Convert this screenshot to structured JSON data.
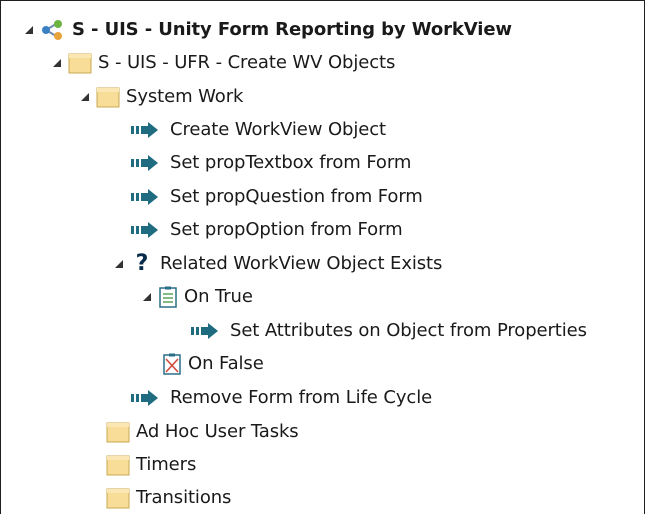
{
  "tree": {
    "root": {
      "label": "S - UIS - Unity Form Reporting by WorkView",
      "icon": "workflow-node-icon",
      "expanded": true
    },
    "lifecycle": {
      "label": "S - UIS - UFR - Create WV Objects",
      "icon": "folder-icon",
      "expanded": true
    },
    "system_work": {
      "label": "System Work",
      "icon": "folder-icon",
      "expanded": true
    },
    "actions": [
      {
        "label": "Create WorkView Object",
        "icon": "action-arrow-icon"
      },
      {
        "label": "Set propTextbox from Form",
        "icon": "action-arrow-icon"
      },
      {
        "label": "Set propQuestion from Form",
        "icon": "action-arrow-icon"
      },
      {
        "label": "Set propOption from Form",
        "icon": "action-arrow-icon"
      }
    ],
    "rule": {
      "label": "Related WorkView Object Exists",
      "icon": "question-mark-icon",
      "expanded": true
    },
    "on_true": {
      "label": "On True",
      "icon": "task-list-icon",
      "expanded": true
    },
    "on_true_action": {
      "label": "Set Attributes on Object from Properties",
      "icon": "action-arrow-icon"
    },
    "on_false": {
      "label": "On False",
      "icon": "disabled-task-list-icon"
    },
    "after_rule_action": {
      "label": "Remove Form from Life Cycle",
      "icon": "action-arrow-icon"
    },
    "other_folders": [
      {
        "label": "Ad Hoc User Tasks",
        "icon": "folder-icon"
      },
      {
        "label": "Timers",
        "icon": "folder-icon"
      },
      {
        "label": "Transitions",
        "icon": "folder-icon"
      }
    ]
  },
  "colors": {
    "action_arrow": "#1f6b7f",
    "folder": "#f5d98b",
    "question": "#0a2a4a",
    "text": "#1a1a1a"
  }
}
